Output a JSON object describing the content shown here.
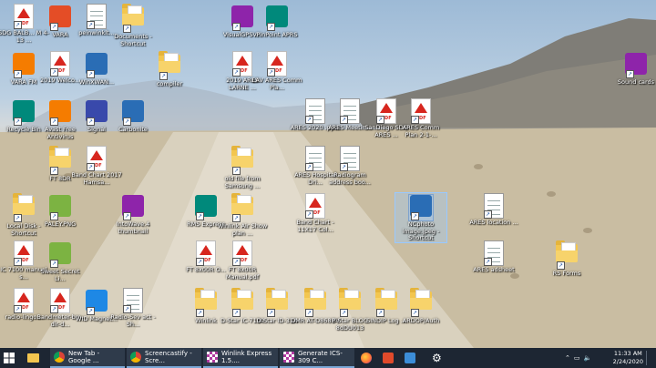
{
  "desktop": {
    "icons": [
      {
        "label": "SDG BALB... M 4-13 ...",
        "type": "pdf"
      },
      {
        "label": "VARA",
        "type": "app"
      },
      {
        "label": "peinwinklt...",
        "type": "doc"
      },
      {
        "label": "Documents - Shortcut",
        "type": "folder"
      },
      {
        "label": "VisualGPSV...",
        "type": "app"
      },
      {
        "label": "PinPoint APRS",
        "type": "app"
      },
      {
        "label": "VARA FM",
        "type": "app"
      },
      {
        "label": "2019 Welco...",
        "type": "pdf"
      },
      {
        "label": "WinXWAN...",
        "type": "app"
      },
      {
        "label": "compiler",
        "type": "folder"
      },
      {
        "label": "2019 ARES LARNE ...",
        "type": "pdf"
      },
      {
        "label": "LAV ARES Comm Pla...",
        "type": "pdf"
      },
      {
        "label": "Sound cards",
        "type": "app"
      },
      {
        "label": "Recycle Bin",
        "type": "app"
      },
      {
        "label": "Avast Free Antivirus",
        "type": "app"
      },
      {
        "label": "Signal",
        "type": "app"
      },
      {
        "label": "Carbonite",
        "type": "app"
      },
      {
        "label": "ARES 2020 .pptx",
        "type": "doc"
      },
      {
        "label": "ARES Meetin...",
        "type": "doc"
      },
      {
        "label": "SanDiego SDG ARES ...",
        "type": "pdf"
      },
      {
        "label": "ARES Comm Plan 2-1-...",
        "type": "pdf"
      },
      {
        "label": "FT 8DR",
        "type": "folder"
      },
      {
        "label": "Band Chart 2017 Hamsa...",
        "type": "pdf"
      },
      {
        "label": "old file from Samsung ...",
        "type": "folder"
      },
      {
        "label": "ARES Hospital Dri...",
        "type": "doc"
      },
      {
        "label": "Radiogram address boo...",
        "type": "doc"
      },
      {
        "label": "Local Disk - Shortcut",
        "type": "folder"
      },
      {
        "label": "PALEY.PNG",
        "type": "app"
      },
      {
        "label": "IntoWave.4 thumbnail",
        "type": "app"
      },
      {
        "label": "RMS Express",
        "type": "app"
      },
      {
        "label": "Winlink Air Show plan ...",
        "type": "folder"
      },
      {
        "label": "Band Chart - 11X17 Col...",
        "type": "pdf"
      },
      {
        "label": "NCphoto image.jpeg - Shortcut",
        "type": "app"
      },
      {
        "label": "ARES location ...",
        "type": "doc"
      },
      {
        "label": "IC 7100 manual s...",
        "type": "pdf"
      },
      {
        "label": "Sweet Secret Li...",
        "type": "app"
      },
      {
        "label": "FT 8x00R O...",
        "type": "pdf"
      },
      {
        "label": "FT 8x00R Manual.pdf",
        "type": "pdf"
      },
      {
        "label": "ARES adsheet",
        "type": "doc"
      },
      {
        "label": "RS Forms",
        "type": "folder"
      },
      {
        "label": "radio-lingo...",
        "type": "pdf"
      },
      {
        "label": "Bandmeter-bm-dir-d...",
        "type": "pdf"
      },
      {
        "label": "WID Magnet...",
        "type": "app"
      },
      {
        "label": "Radio-Sev act - Sh...",
        "type": "doc"
      },
      {
        "label": "Winlink",
        "type": "folder"
      },
      {
        "label": "D-Star IC-7100",
        "type": "folder"
      },
      {
        "label": "D-Star ID-31A",
        "type": "folder"
      },
      {
        "label": "DMR AT-D868UV",
        "type": "folder"
      },
      {
        "label": "P-Star BLOG 8dDU013",
        "type": "folder"
      },
      {
        "label": "SINDIP Log ...",
        "type": "folder"
      },
      {
        "label": "ARDOP/Auth",
        "type": "folder"
      }
    ]
  },
  "taskbar": {
    "buttons": [
      {
        "label": "New Tab - Google ..."
      },
      {
        "label": "Screencastify - Scre..."
      },
      {
        "label": "Winlink Express 1.5...."
      },
      {
        "label": "Generate ICS-309 C..."
      }
    ],
    "clock": {
      "time": "11:33 AM",
      "date": "2/24/2020"
    },
    "colors": {
      "taskbar": "#1d2633",
      "accent": "#7aa7d6"
    }
  }
}
